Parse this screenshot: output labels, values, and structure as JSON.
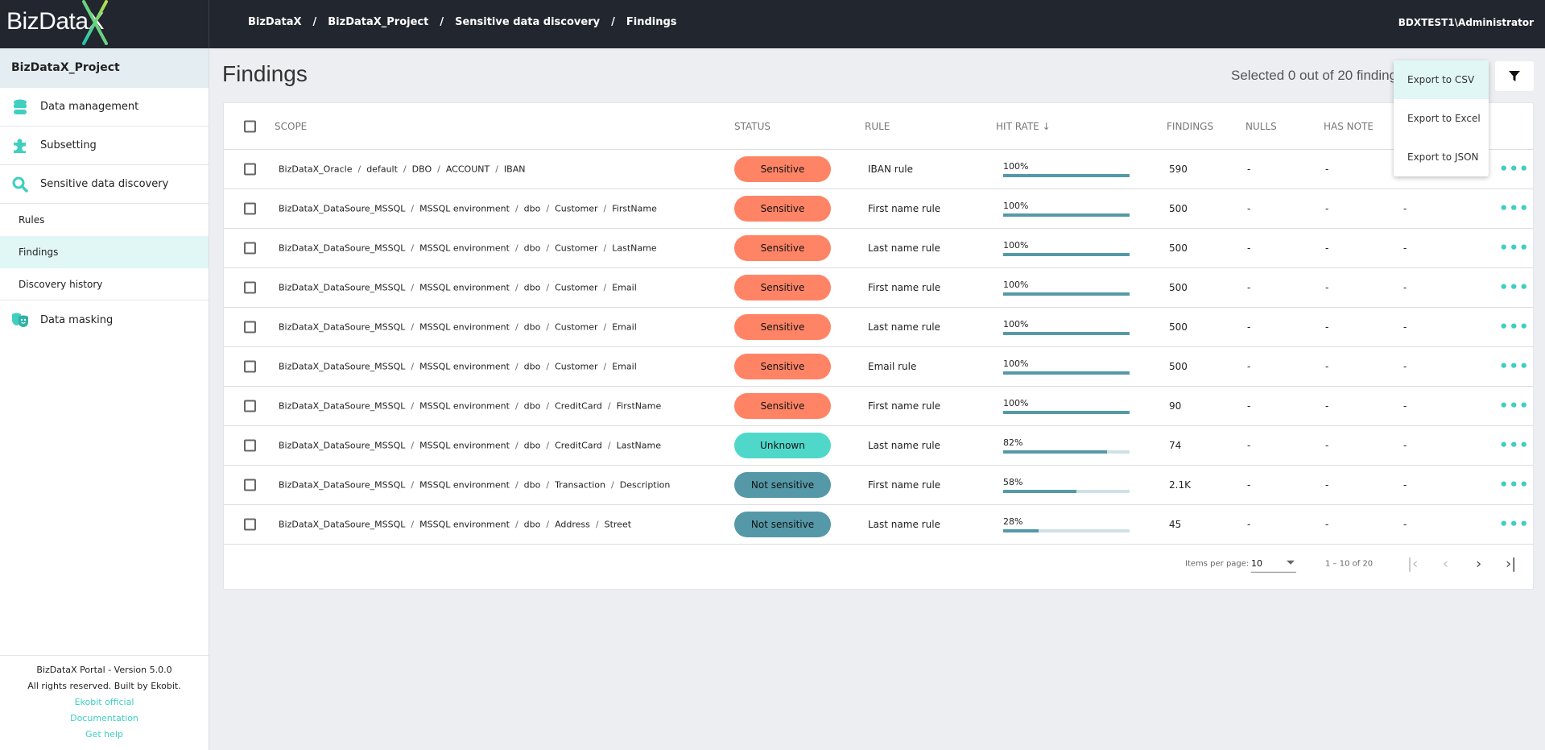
{
  "app": {
    "logo": "BizDataX",
    "user": "BDXTEST1\\Administrator",
    "colors": {
      "header": "#22262f",
      "accent": "#3fcfc1",
      "sensitive": "#ff8466",
      "unknown": "#4fd8ca",
      "not_sensitive": "#5599a8"
    }
  },
  "breadcrumb": [
    "BizDataX",
    "BizDataX_Project",
    "Sensitive data discovery",
    "Findings"
  ],
  "sidebar": {
    "project": "BizDataX_Project",
    "items": [
      {
        "label": "Data management",
        "icon": "database-icon"
      },
      {
        "label": "Subsetting",
        "icon": "puzzle-icon"
      },
      {
        "label": "Sensitive data discovery",
        "icon": "search-icon"
      }
    ],
    "subitems": [
      {
        "label": "Rules"
      },
      {
        "label": "Findings",
        "active": true
      },
      {
        "label": "Discovery history"
      }
    ],
    "masking": {
      "label": "Data masking",
      "icon": "masks-icon"
    },
    "footer": {
      "version": "BizDataX Portal - Version 5.0.0",
      "rights": "All rights reserved. Built by Ekobit.",
      "links": [
        "Ekobit official",
        "Documentation",
        "Get help"
      ]
    }
  },
  "page": {
    "title": "Findings",
    "selected": "Selected 0 out of 20 findings"
  },
  "export_menu": [
    "Export to CSV",
    "Export to Excel",
    "Export to JSON"
  ],
  "table": {
    "headers": {
      "scope": "SCOPE",
      "status": "STATUS",
      "rule": "RULE",
      "hit_rate": "HIT RATE",
      "findings": "FINDINGS",
      "nulls": "NULLS",
      "has_note": "HAS NOTE"
    },
    "sort": {
      "column": "hit_rate",
      "direction": "descending"
    },
    "rows": [
      {
        "scope": [
          "BizDataX_Oracle",
          "default",
          "DBO",
          "ACCOUNT",
          "IBAN"
        ],
        "status": "Sensitive",
        "rule": "IBAN rule",
        "hit_rate": 100,
        "hit_label": "100%",
        "findings": "590",
        "nulls": "-",
        "has_note": "-",
        "extra": "-"
      },
      {
        "scope": [
          "BizDataX_DataSoure_MSSQL",
          "MSSQL environment",
          "dbo",
          "Customer",
          "FirstName"
        ],
        "status": "Sensitive",
        "rule": "First name rule",
        "hit_rate": 100,
        "hit_label": "100%",
        "findings": "500",
        "nulls": "-",
        "has_note": "-",
        "extra": "-"
      },
      {
        "scope": [
          "BizDataX_DataSoure_MSSQL",
          "MSSQL environment",
          "dbo",
          "Customer",
          "LastName"
        ],
        "status": "Sensitive",
        "rule": "Last name rule",
        "hit_rate": 100,
        "hit_label": "100%",
        "findings": "500",
        "nulls": "-",
        "has_note": "-",
        "extra": "-"
      },
      {
        "scope": [
          "BizDataX_DataSoure_MSSQL",
          "MSSQL environment",
          "dbo",
          "Customer",
          "Email"
        ],
        "status": "Sensitive",
        "rule": "First name rule",
        "hit_rate": 100,
        "hit_label": "100%",
        "findings": "500",
        "nulls": "-",
        "has_note": "-",
        "extra": "-"
      },
      {
        "scope": [
          "BizDataX_DataSoure_MSSQL",
          "MSSQL environment",
          "dbo",
          "Customer",
          "Email"
        ],
        "status": "Sensitive",
        "rule": "Last name rule",
        "hit_rate": 100,
        "hit_label": "100%",
        "findings": "500",
        "nulls": "-",
        "has_note": "-",
        "extra": "-"
      },
      {
        "scope": [
          "BizDataX_DataSoure_MSSQL",
          "MSSQL environment",
          "dbo",
          "Customer",
          "Email"
        ],
        "status": "Sensitive",
        "rule": "Email rule",
        "hit_rate": 100,
        "hit_label": "100%",
        "findings": "500",
        "nulls": "-",
        "has_note": "-",
        "extra": "-"
      },
      {
        "scope": [
          "BizDataX_DataSoure_MSSQL",
          "MSSQL environment",
          "dbo",
          "CreditCard",
          "FirstName"
        ],
        "status": "Sensitive",
        "rule": "First name rule",
        "hit_rate": 100,
        "hit_label": "100%",
        "findings": "90",
        "nulls": "-",
        "has_note": "-",
        "extra": "-"
      },
      {
        "scope": [
          "BizDataX_DataSoure_MSSQL",
          "MSSQL environment",
          "dbo",
          "CreditCard",
          "LastName"
        ],
        "status": "Unknown",
        "rule": "Last name rule",
        "hit_rate": 82,
        "hit_label": "82%",
        "findings": "74",
        "nulls": "-",
        "has_note": "-",
        "extra": "-"
      },
      {
        "scope": [
          "BizDataX_DataSoure_MSSQL",
          "MSSQL environment",
          "dbo",
          "Transaction",
          "Description"
        ],
        "status": "Not sensitive",
        "rule": "First name rule",
        "hit_rate": 58,
        "hit_label": "58%",
        "findings": "2.1K",
        "nulls": "-",
        "has_note": "-",
        "extra": "-"
      },
      {
        "scope": [
          "BizDataX_DataSoure_MSSQL",
          "MSSQL environment",
          "dbo",
          "Address",
          "Street"
        ],
        "status": "Not sensitive",
        "rule": "Last name rule",
        "hit_rate": 28,
        "hit_label": "28%",
        "findings": "45",
        "nulls": "-",
        "has_note": "-",
        "extra": "-"
      }
    ]
  },
  "pagination": {
    "items_per_page_label": "Items per page:",
    "items_per_page": "10",
    "range": "1 – 10 of 20"
  }
}
